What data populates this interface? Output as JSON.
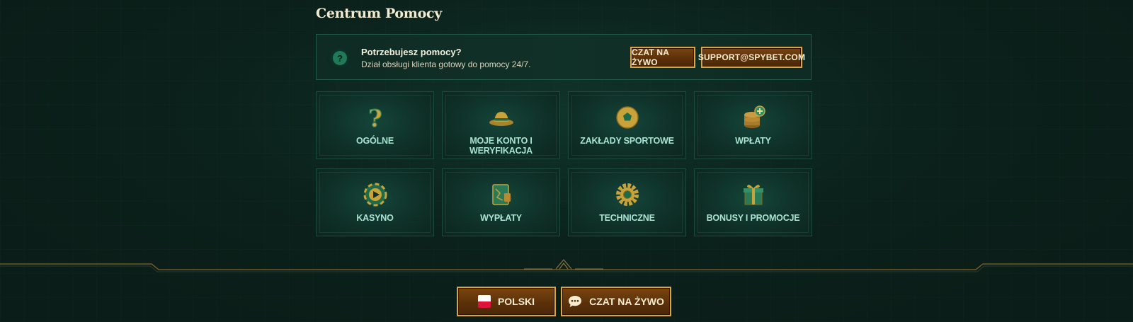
{
  "page": {
    "title": "Centrum Pomocy"
  },
  "help_banner": {
    "icon": "question-circle-icon",
    "heading": "Potrzebujesz pomocy?",
    "subtext": "Dział obsługi klienta gotowy do pomocy 24/7.",
    "chat_button": "CZAT NA ŻYWO",
    "email_button": "SUPPORT@SPYBET.COM"
  },
  "categories": [
    {
      "label": "OGÓLNE",
      "icon": "question-mark-icon"
    },
    {
      "label": "MOJE KONTO I WERYFIKACJA",
      "icon": "hat-icon"
    },
    {
      "label": "ZAKŁADY SPORTOWE",
      "icon": "football-icon"
    },
    {
      "label": "WPŁATY",
      "icon": "coin-stack-icon"
    },
    {
      "label": "KASYNO",
      "icon": "casino-chip-icon"
    },
    {
      "label": "WYPŁATY",
      "icon": "wallet-map-icon"
    },
    {
      "label": "TECHNICZNE",
      "icon": "gear-icon"
    },
    {
      "label": "BONUSY I PROMOCJE",
      "icon": "gift-box-icon"
    }
  ],
  "footer": {
    "language_button": "POLSKI",
    "language_icon": "poland-flag-icon",
    "live_chat_button": "CZAT NA ŻYWO",
    "live_chat_icon": "chat-bubble-icon"
  },
  "colors": {
    "background": "#0b1d18",
    "gold_border": "#d9a441",
    "button_fill": "#5c3109",
    "tile_label": "#a9e4d0",
    "accent_green": "#1f7a5a"
  }
}
